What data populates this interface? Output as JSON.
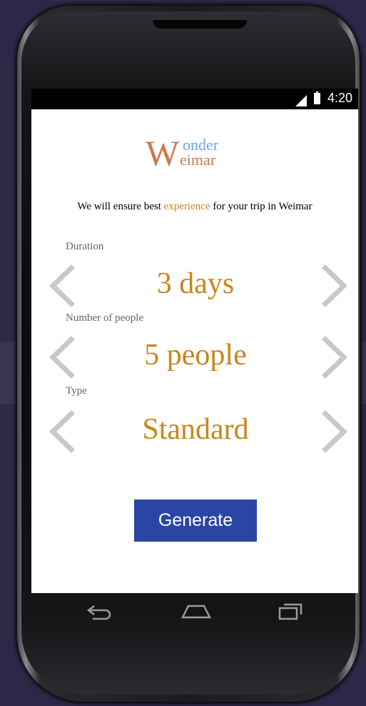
{
  "status_bar": {
    "time": "4:20"
  },
  "logo": {
    "initial": "W",
    "top_line": "onder",
    "bottom_line": "eimar"
  },
  "tagline": {
    "before": "We will ensure best ",
    "accent": "experience",
    "after": " for your trip in Weimar"
  },
  "fields": [
    {
      "label": "Duration",
      "value": "3 days"
    },
    {
      "label": "Number of people",
      "value": "5 people"
    },
    {
      "label": "Type",
      "value": "Standard"
    }
  ],
  "generate_label": "Generate",
  "icons": {
    "prev": "chevron-left-icon",
    "next": "chevron-right-icon",
    "nav_back": "back-icon",
    "nav_home": "home-icon",
    "nav_recents": "recents-icon"
  },
  "colors": {
    "accent": "#c9861b",
    "logo_orange": "#c87a4a",
    "logo_blue": "#6aa7e0",
    "button": "#2a46a5",
    "chevron": "#c8c8c8"
  }
}
